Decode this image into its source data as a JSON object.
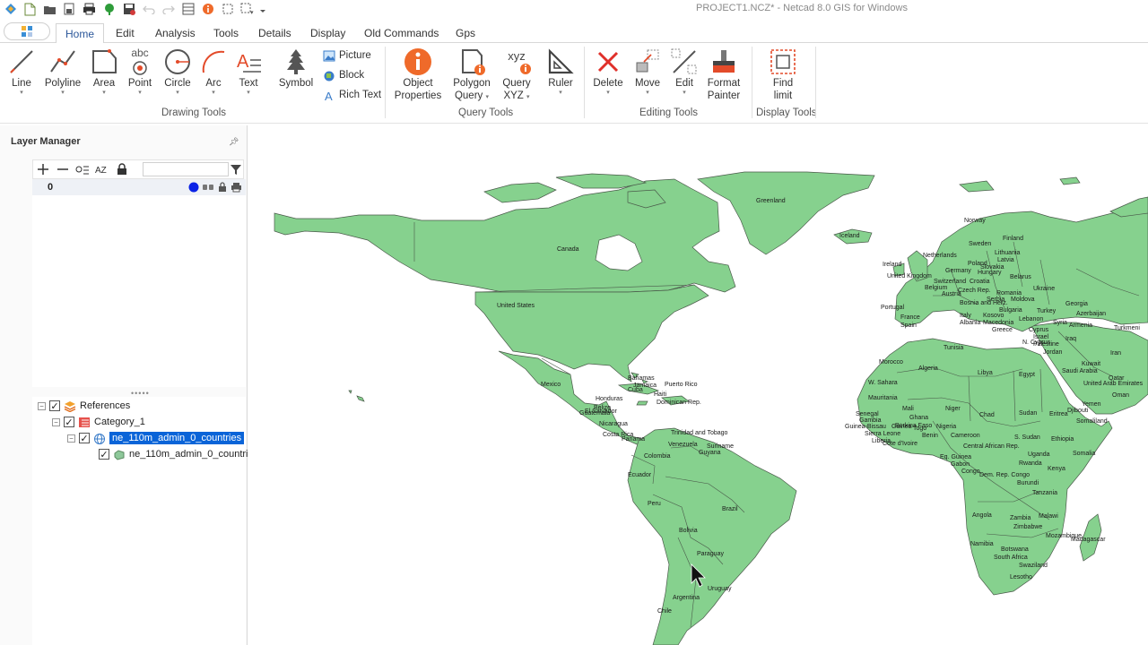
{
  "window": {
    "title": "PROJECT1.NCZ* - Netcad 8.0 GIS for Windows"
  },
  "tabs": [
    "Home",
    "Edit",
    "Analysis",
    "Tools",
    "Details",
    "Display",
    "Old Commands",
    "Gps"
  ],
  "active_tab": "Home",
  "ribbon": {
    "drawing_tools": {
      "group_label": "Drawing Tools",
      "buttons": [
        "Line",
        "Polyline",
        "Area",
        "Point",
        "Circle",
        "Arc",
        "Text",
        "Symbol"
      ],
      "small_buttons": [
        "Picture",
        "Block",
        "Rich Text"
      ]
    },
    "query_tools": {
      "group_label": "Query Tools",
      "object_properties": [
        "Object",
        "Properties"
      ],
      "polygon_query": [
        "Polygon",
        "Query"
      ],
      "query_xyz": [
        "Query",
        "XYZ"
      ],
      "ruler": "Ruler",
      "xyz_icon_text": "xyz"
    },
    "editing_tools": {
      "group_label": "Editing Tools",
      "buttons": [
        "Delete",
        "Move",
        "Edit"
      ],
      "format_painter": [
        "Format",
        "Painter"
      ]
    },
    "display_tools": {
      "group_label": "Display Tools",
      "find_limit": [
        "Find",
        "limit"
      ]
    }
  },
  "layer_manager": {
    "title": "Layer Manager",
    "search_placeholder": "",
    "layers": [
      {
        "name": "0"
      }
    ],
    "references": {
      "root": "References",
      "category": "Category_1",
      "layer_group": "ne_110m_admin_0_countries",
      "layer": "ne_110m_admin_0_countrie"
    }
  },
  "map": {
    "land_color": "#86d18e",
    "labels": {
      "greenland": "Greenland",
      "canada": "Canada",
      "united_states": "United States",
      "mexico": "Mexico",
      "iceland": "Iceland",
      "norway": "Norway",
      "sweden": "Sweden",
      "finland": "Finland",
      "ireland": "Ireland",
      "united_kingdom": "United Kingdom",
      "netherlands": "Netherlands",
      "belgium": "Belgium",
      "germany": "Germany",
      "poland": "Poland",
      "lithuania": "Lithuania",
      "latvia": "Latvia",
      "belarus": "Belarus",
      "ukraine": "Ukraine",
      "czech_rep": "Czech Rep.",
      "switzerland": "Switzerland",
      "croatia": "Croatia",
      "hungary": "Hungary",
      "slovakia": "Slovakia",
      "austria": "Austria",
      "romania": "Romania",
      "moldova": "Moldova",
      "serbia": "Serbia",
      "bosnia": "Bosnia and Herz.",
      "bulgaria": "Bulgaria",
      "kosovo": "Kosovo",
      "macedonia": "Macedonia",
      "greece": "Greece",
      "albania": "Albania",
      "italy": "Italy",
      "france": "France",
      "spain": "Spain",
      "portugal": "Portugal",
      "turkey": "Turkey",
      "georgia": "Georgia",
      "azerbaijan": "Azerbaijan",
      "armenia": "Armenia",
      "cyprus": "Cyprus",
      "n_cyprus": "N. Cyprus",
      "lebanon": "Lebanon",
      "syria": "Syria",
      "iraq": "Iraq",
      "iran": "Iran",
      "israel": "Israel",
      "palestine": "Palestine",
      "jordan": "Jordan",
      "kuwait": "Kuwait",
      "turkmenistan": "Turkmeni",
      "saudi_arabia": "Saudi Arabia",
      "uae": "United Arab Emirates",
      "qatar": "Qatar",
      "oman": "Oman",
      "yemen": "Yemen",
      "morocco": "Morocco",
      "tunisia": "Tunisia",
      "algeria": "Algeria",
      "libya": "Libya",
      "egypt": "Egypt",
      "w_sahara": "W. Sahara",
      "mauritania": "Mauritania",
      "mali": "Mali",
      "niger": "Niger",
      "chad": "Chad",
      "sudan": "Sudan",
      "eritrea": "Eritrea",
      "djibouti": "Djibouti",
      "somaliland": "Somaliland",
      "somalia": "Somalia",
      "ethiopia": "Ethiopia",
      "s_sudan": "S. Sudan",
      "senegal": "Senegal",
      "gambia": "Gambia",
      "guinea_bissau": "Guinea-Bissau",
      "guinea": "Guinea",
      "sierra_leone": "Sierra Leone",
      "liberia": "Liberia",
      "cote_divoire": "Côte d'Ivoire",
      "ghana": "Ghana",
      "burkina_faso": "Burkina Faso",
      "benin": "Benin",
      "togo": "Togo",
      "nigeria": "Nigeria",
      "cameroon": "Cameroon",
      "car": "Central African Rep.",
      "eq_guinea": "Eq. Guinea",
      "gabon": "Gabon",
      "congo": "Congo",
      "drc": "Dem. Rep. Congo",
      "uganda": "Uganda",
      "kenya": "Kenya",
      "rwanda": "Rwanda",
      "burundi": "Burundi",
      "tanzania": "Tanzania",
      "angola": "Angola",
      "zambia": "Zambia",
      "malawi": "Malawi",
      "mozambique": "Mozambique",
      "zimbabwe": "Zimbabwe",
      "namibia": "Namibia",
      "botswana": "Botswana",
      "south_africa": "South Africa",
      "swaziland": "Swaziland",
      "lesotho": "Lesotho",
      "madagascar": "Madagascar",
      "bahamas": "Bahamas",
      "cuba": "Cuba",
      "jamaica": "Jamaica",
      "haiti": "Haiti",
      "dominican_rep": "Dominican Rep.",
      "puerto_rico": "Puerto Rico",
      "belize": "Belize",
      "guatemala": "Guatemala",
      "honduras": "Honduras",
      "el_salvador": "El Salvador",
      "nicaragua": "Nicaragua",
      "costa_rica": "Costa Rica",
      "panama": "Panama",
      "trinidad": "Trinidad and Tobago",
      "venezuela": "Venezuela",
      "guyana": "Guyana",
      "suriname": "Suriname",
      "colombia": "Colombia",
      "ecuador": "Ecuador",
      "peru": "Peru",
      "brazil": "Brazil",
      "bolivia": "Bolivia",
      "paraguay": "Paraguay",
      "uruguay": "Uruguay",
      "argentina": "Argentina",
      "chile": "Chile"
    }
  }
}
